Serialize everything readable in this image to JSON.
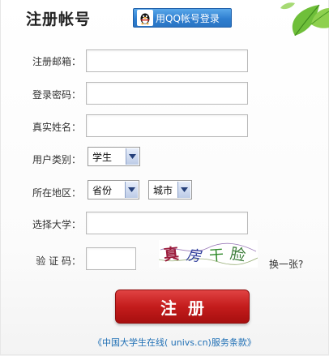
{
  "header": {
    "title": "注册帐号",
    "qq_login_label": "用QQ帐号登录"
  },
  "form": {
    "email_label": "注册邮箱：",
    "email_value": "",
    "password_label": "登录密码：",
    "password_value": "",
    "realname_label": "真实姓名：",
    "realname_value": "",
    "usertype_label": "用户类别：",
    "usertype_value": "学生",
    "region_label": "所在地区：",
    "province_value": "省份",
    "city_value": "城市",
    "university_label": "选择大学：",
    "university_value": "",
    "captcha_label": "验 证 码：",
    "captcha_value": "",
    "captcha_text": "真房干脸",
    "change_captcha_label": "换一张?"
  },
  "actions": {
    "submit_label": "注册",
    "terms_label": "《中国大学生在线( univs.cn)服务条款》"
  },
  "colors": {
    "submit_red": "#c41c1c",
    "qq_blue": "#2f7fd0",
    "link_blue": "#1f6fb5"
  }
}
